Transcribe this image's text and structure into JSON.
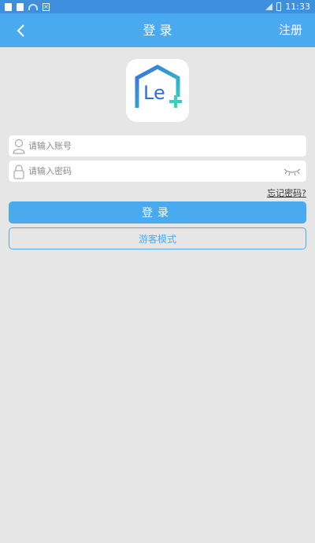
{
  "status_bar": {
    "time": "11:33"
  },
  "nav": {
    "title": "登 录",
    "register_label": "注册"
  },
  "form": {
    "account_placeholder": "请输入账号",
    "password_placeholder": "请输入密码",
    "forgot_label": "忘记密码?",
    "login_label": "登录",
    "guest_label": "游客模式"
  },
  "logo": {
    "text": "Le"
  },
  "colors": {
    "primary": "#4aaaf0",
    "status_bar": "#3f8fdf",
    "background": "#e6e6e6",
    "logo_gradient_start": "#3a6fe0",
    "logo_gradient_end": "#2fd3c0"
  },
  "icons": {
    "back": "chevron-left-icon",
    "user": "user-icon",
    "lock": "lock-icon",
    "eye": "eye-closed-icon"
  }
}
